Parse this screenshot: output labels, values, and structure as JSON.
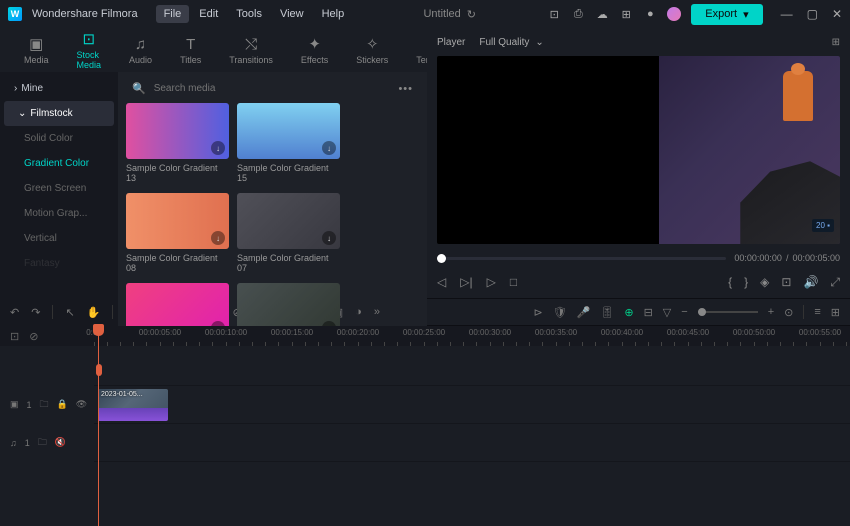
{
  "app": {
    "name": "Wondershare Filmora",
    "title": "Untitled",
    "export": "Export"
  },
  "menu": [
    "File",
    "Edit",
    "Tools",
    "View",
    "Help"
  ],
  "tabs": [
    {
      "l": "Media"
    },
    {
      "l": "Stock Media"
    },
    {
      "l": "Audio"
    },
    {
      "l": "Titles"
    },
    {
      "l": "Transitions"
    },
    {
      "l": "Effects"
    },
    {
      "l": "Stickers"
    },
    {
      "l": "Templates"
    }
  ],
  "sidebar": {
    "mine": "Mine",
    "filmstock": "Filmstock",
    "subs": [
      "Solid Color",
      "Gradient Color",
      "Green Screen",
      "Motion Grap...",
      "Vertical",
      "Fantasy"
    ]
  },
  "search": {
    "placeholder": "Search media"
  },
  "thumbs": [
    {
      "n": "Sample Color Gradient 13",
      "g": "linear-gradient(90deg,#e050a0,#5060e0)"
    },
    {
      "n": "Sample Color Gradient 15",
      "g": "linear-gradient(180deg,#80d0f0,#5080d0)"
    },
    {
      "n": "Sample Color Gradient 08",
      "g": "linear-gradient(90deg,#f09068,#e07050)"
    },
    {
      "n": "Sample Color Gradient 07",
      "g": "linear-gradient(135deg,#505058,#383840)"
    },
    {
      "n": "",
      "g": "linear-gradient(135deg,#f04080,#e020b0)"
    },
    {
      "n": "",
      "g": "linear-gradient(135deg,#485050,#303832)"
    }
  ],
  "player": {
    "label": "Player",
    "quality": "Full Quality",
    "cur": "00:00:00:00",
    "dur": "00:00:05:00"
  },
  "ruler": [
    "0:00",
    "00:00:05:00",
    "00:00:10:00",
    "00:00:15:00",
    "00:00:20:00",
    "00:00:25:00",
    "00:00:30:00",
    "00:00:35:00",
    "00:00:40:00",
    "00:00:45:00",
    "00:00:50:00",
    "00:00:55:00"
  ],
  "clip": {
    "name": "2023-01-05..."
  },
  "tracks": {
    "video": "1",
    "audio": "1"
  }
}
